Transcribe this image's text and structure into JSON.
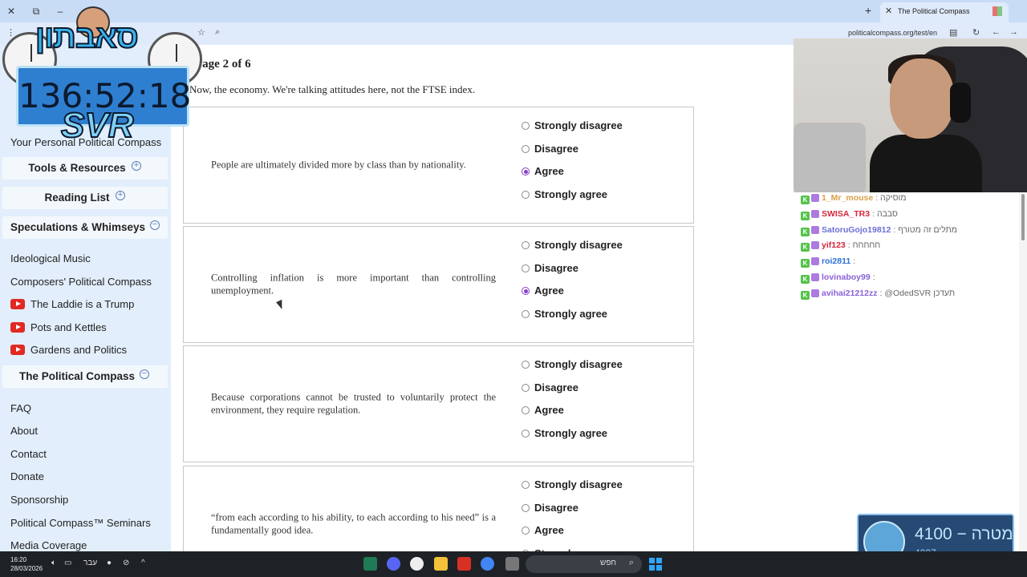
{
  "browser": {
    "tab_title": "The Political Compass",
    "url": "politicalcompass.org/test/en",
    "tab_close": "✕",
    "new_tab": "+"
  },
  "sidebar": {
    "personal_link": "Your Personal Political Compass",
    "sections": [
      {
        "label": "Tools & Resources",
        "toggle": "+"
      },
      {
        "label": "Reading List",
        "toggle": "+"
      },
      {
        "label": "Speculations & Whimseys",
        "toggle": "−"
      },
      {
        "label": "The Political Compass",
        "toggle": "−"
      }
    ],
    "speculations_items": [
      "Ideological Music",
      "Composers' Political Compass"
    ],
    "video_items": [
      "The Laddie is a Trump",
      "Pots and Kettles",
      "Gardens and Politics"
    ],
    "compass_items": [
      "FAQ",
      "About",
      "Contact",
      "Donate",
      "Sponsorship",
      "Political Compass™ Seminars",
      "Media Coverage"
    ]
  },
  "main": {
    "heading": "Page 2 of 6",
    "intro": "Now, the economy. We're talking attitudes here, not the FTSE index.",
    "options": [
      "Strongly disagree",
      "Disagree",
      "Agree",
      "Strongly agree"
    ],
    "questions": [
      {
        "text": "People are ultimately divided more by class than by nationality.",
        "selected": "Agree"
      },
      {
        "text": "Controlling inflation is more important than controlling unemployment.",
        "selected": "Agree"
      },
      {
        "text": "Because corporations cannot be trusted to voluntarily protect the environment, they require regulation.",
        "selected": ""
      },
      {
        "text": "“from each according to his ability, to each according to his need” is a fundamentally good idea.",
        "selected": ""
      }
    ]
  },
  "overlay": {
    "timer": "136:52:18",
    "logo_text": "SVR",
    "hebrew_logo": "סאבתון"
  },
  "chat": [
    {
      "user": "1_Mr_mouse",
      "msg": "מוסיקה",
      "color": "#d9a04a"
    },
    {
      "user": "SWISA_TR3",
      "msg": "סבבה",
      "color": "#d5263c"
    },
    {
      "user": "SatoruGojo19812",
      "msg": "מתלים זה מטורף",
      "color": "#6b6fd6"
    },
    {
      "user": "yif123",
      "msg": "חחחחח",
      "color": "#d5263c"
    },
    {
      "user": "roi2811",
      "msg": "",
      "color": "#2e6fd9"
    },
    {
      "user": "lovinaboy99",
      "msg": "",
      "color": "#8a62d8"
    },
    {
      "user": "avihai21212zz",
      "msg": "@OdedSVR תעדכן",
      "color": "#8a62d8"
    }
  ],
  "goal": {
    "title": "מטרה",
    "target": "4100",
    "current": "4007"
  },
  "taskbar": {
    "time": "16:20",
    "date": "28/03/2026",
    "lang": "עבר",
    "search_label": "חפש"
  },
  "colors": {
    "accent_radio": "#8a3fc7",
    "sidebar_bg": "#e2eefb",
    "timer_bg": "#2f7fd0"
  }
}
